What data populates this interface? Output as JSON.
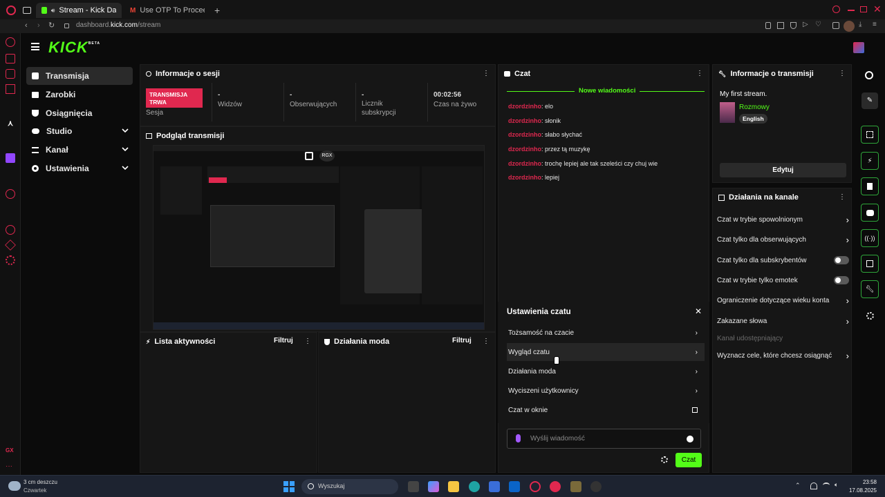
{
  "browser": {
    "tabs": [
      {
        "label": "Stream - Kick Dashbo",
        "active": true
      },
      {
        "label": "Use OTP To Proceed - are",
        "active": false
      }
    ],
    "url_prefix": "dashboard.",
    "url_host": "kick.com",
    "url_path": "/stream"
  },
  "app": {
    "logo": "KICK",
    "logo_badge": "BETA",
    "accent": "#53fc18"
  },
  "sidebar": {
    "items": [
      {
        "label": "Transmisja",
        "icon": "video-icon",
        "active": true
      },
      {
        "label": "Zarobki",
        "icon": "wallet-icon"
      },
      {
        "label": "Osiągnięcia",
        "icon": "trophy-icon"
      },
      {
        "label": "Studio",
        "icon": "gamepad-icon",
        "expandable": true
      },
      {
        "label": "Kanał",
        "icon": "menu-icon",
        "expandable": true
      },
      {
        "label": "Ustawienia",
        "icon": "gear-icon",
        "expandable": true
      }
    ]
  },
  "session": {
    "title": "Informacje o sesji",
    "live_badge": "TRANSMISJA TRWA",
    "session_label": "Sesja",
    "stats": [
      {
        "value": "-",
        "label": "Widzów"
      },
      {
        "value": "-",
        "label": "Obserwujących"
      },
      {
        "value": "-",
        "label": "Licznik subskrypcji"
      },
      {
        "value": "00:02:56",
        "label": "Czas na żywo"
      }
    ]
  },
  "preview": {
    "title": "Podgląd transmisji",
    "badge": "RGX"
  },
  "activity": {
    "title": "Lista aktywności",
    "filter": "Filtruj"
  },
  "mod_actions": {
    "title": "Działania moda",
    "filter": "Filtruj"
  },
  "chat": {
    "title": "Czat",
    "divider": "Nowe wiadomości",
    "messages": [
      {
        "user": "dzordzinho",
        "text": ": elo"
      },
      {
        "user": "dzordzinho",
        "text": ": słonik"
      },
      {
        "user": "dzordzinho",
        "text": ": słabo słychać"
      },
      {
        "user": "dzordzinho",
        "text": ": przez tą muzykę"
      },
      {
        "user": "dzordzinho",
        "text": ": trochę lepiej ale tak szeleści czy chuj wie"
      },
      {
        "user": "dzordzinho",
        "text": ": lepiej"
      }
    ],
    "settings": {
      "title": "Ustawienia czatu",
      "rows": [
        {
          "label": "Tożsamość na czacie"
        },
        {
          "label": "Wygląd czatu"
        },
        {
          "label": "Działania moda"
        },
        {
          "label": "Wyciszeni użytkownicy"
        },
        {
          "label": "Czat w oknie"
        }
      ]
    },
    "input_placeholder": "Wyślij wiadomość",
    "send_label": "Czat"
  },
  "stream_info": {
    "title": "Informacje o transmisji",
    "stream_title": "My first stream.",
    "category": "Rozmowy",
    "language": "English",
    "edit_label": "Edytuj"
  },
  "channel_actions": {
    "title": "Działania na kanale",
    "items": [
      {
        "label": "Czat w trybie spowolnionym",
        "control": "chevron"
      },
      {
        "label": "Czat tylko dla obserwujących",
        "control": "chevron"
      },
      {
        "label": "Czat tylko dla subskrybentów",
        "control": "toggle"
      },
      {
        "label": "Czat w trybie tylko emotek",
        "control": "toggle"
      },
      {
        "label": "Ograniczenie dotyczące wieku konta",
        "control": "chevron"
      },
      {
        "label": "Zakazane słowa",
        "control": "chevron"
      },
      {
        "label": "Kanał udostępniający",
        "control": "none",
        "disabled": true
      },
      {
        "label": "Wyznacz cele, które chcesz osiągnąć",
        "control": "chevron"
      }
    ]
  },
  "taskbar": {
    "weather_temp": "3 cm deszczu",
    "weather_day": "Czwartek",
    "search_placeholder": "Wyszukaj",
    "time": "23:58",
    "date": "17.08.2025"
  }
}
